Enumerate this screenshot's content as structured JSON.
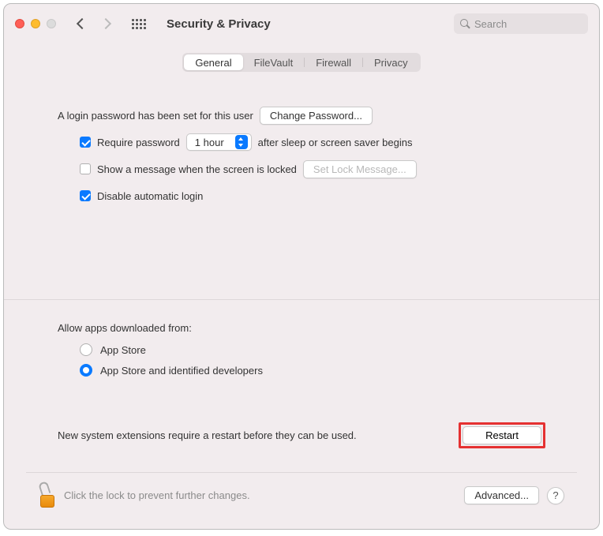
{
  "toolbar": {
    "title": "Security & Privacy",
    "search_placeholder": "Search"
  },
  "tabs": [
    {
      "label": "General",
      "active": true
    },
    {
      "label": "FileVault",
      "active": false
    },
    {
      "label": "Firewall",
      "active": false
    },
    {
      "label": "Privacy",
      "active": false
    }
  ],
  "login": {
    "password_set": "A login password has been set for this user",
    "change_password": "Change Password...",
    "require_password_label": "Require password",
    "require_password_delay": "1 hour",
    "require_password_suffix": "after sleep or screen saver begins",
    "show_message_label": "Show a message when the screen is locked",
    "set_lock_message": "Set Lock Message...",
    "disable_auto_login": "Disable automatic login"
  },
  "downloads": {
    "title": "Allow apps downloaded from:",
    "option1": "App Store",
    "option2": "App Store and identified developers"
  },
  "restart": {
    "message": "New system extensions require a restart before they can be used.",
    "button": "Restart"
  },
  "footer": {
    "lock_text": "Click the lock to prevent further changes.",
    "advanced": "Advanced...",
    "help": "?"
  }
}
